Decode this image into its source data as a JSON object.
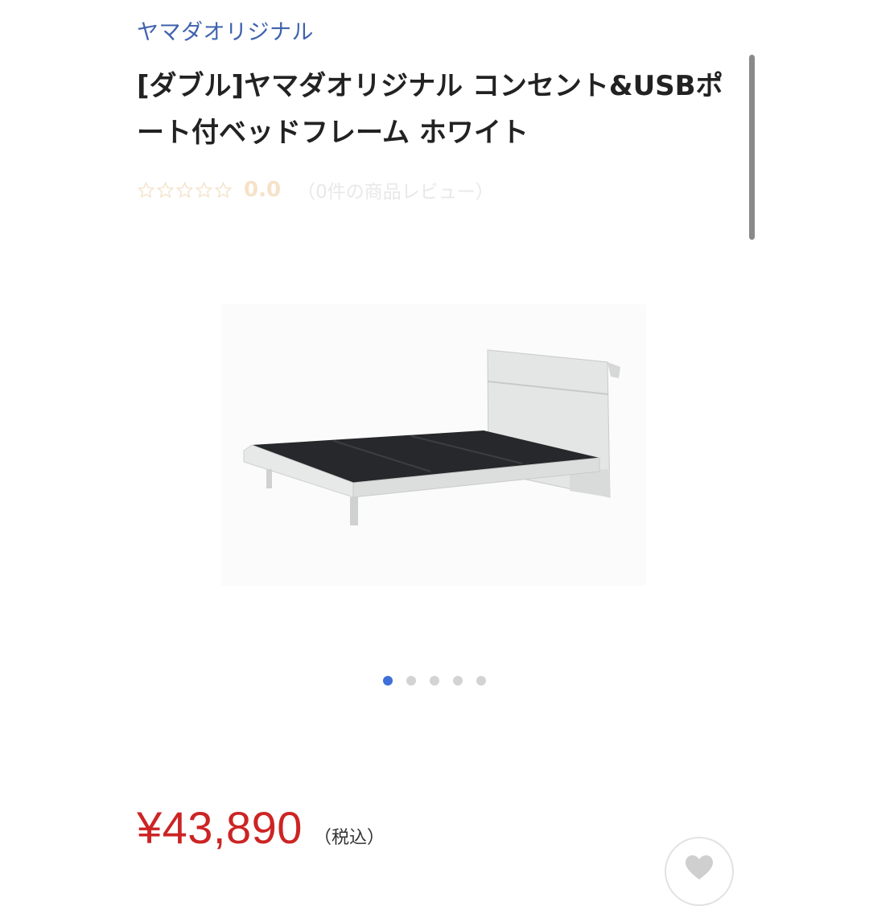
{
  "brand": {
    "label": "ヤマダオリジナル"
  },
  "product": {
    "title": "[ダブル]ヤマダオリジナル コンセント&USBポート付ベッドフレーム ホワイト",
    "rating": {
      "value": "0.0",
      "stars": 0,
      "max_stars": 5,
      "review_text": "（0件の商品レビュー）"
    },
    "price": "¥43,890",
    "tax_label": "（税込）"
  },
  "gallery": {
    "image_count": 5,
    "active_index": 0
  },
  "colors": {
    "brand_link": "#3f62ad",
    "price": "#cc2424",
    "active_dot": "#3f6fd8"
  },
  "icons": {
    "favorite": "heart-icon",
    "rating": "star-outline-icon"
  }
}
